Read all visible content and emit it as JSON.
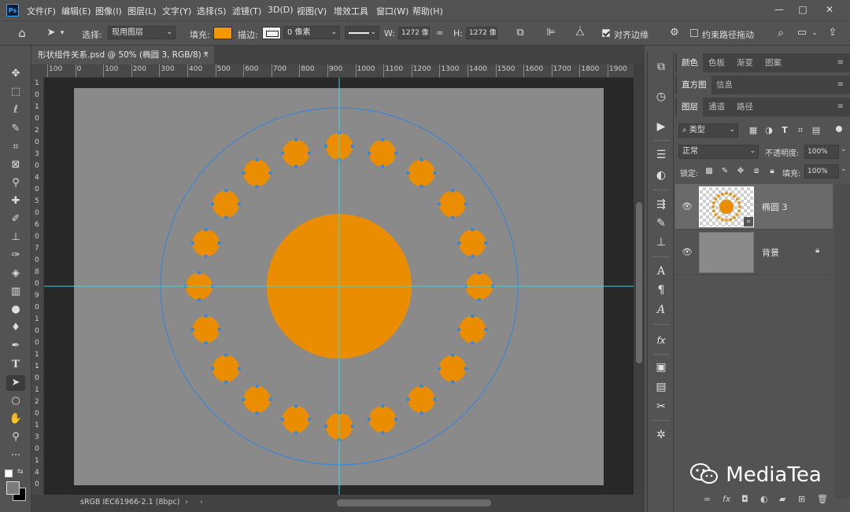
{
  "app": {
    "logo": "Ps",
    "menu": [
      "文件(F)",
      "编辑(E)",
      "图像(I)",
      "图层(L)",
      "文字(Y)",
      "选择(S)",
      "滤镜(T)",
      "3D(D)",
      "视图(V)",
      "增效工具",
      "窗口(W)",
      "帮助(H)"
    ],
    "window_controls": [
      "—",
      "□",
      "✕"
    ]
  },
  "options_bar": {
    "select_label": "选择:",
    "select_value": "现用图层",
    "fill_label": "填充:",
    "fill_color": "#F39800",
    "stroke_label": "描边:",
    "stroke_width": "0 像素",
    "w_label": "W:",
    "w_value": "1272 像",
    "h_label": "H:",
    "h_value": "1272 像",
    "align_edges_label": "对齐边缘",
    "align_edges_checked": true,
    "constrain_path_label": "约束路径拖动",
    "constrain_path_checked": false
  },
  "document": {
    "tab_title": "形状组件关系.psd @ 50% (椭圆 3, RGB/8) *",
    "close": "×",
    "status_text": "sRGB IEC61966-2.1 (8bpc)",
    "status_arrow": "›",
    "status_left_arrow": "‹",
    "ruler_h_ticks": [
      "100",
      "0",
      "100",
      "200",
      "300",
      "400",
      "500",
      "600",
      "700",
      "800",
      "900",
      "1000",
      "1100",
      "1200",
      "1300",
      "1400",
      "1500",
      "1600",
      "1700",
      "1800",
      "1900"
    ],
    "ruler_v_ticks": [
      "1",
      "0",
      "1",
      "0",
      "2",
      "0",
      "3",
      "0",
      "4",
      "0",
      "5",
      "0",
      "6",
      "0",
      "7",
      "0",
      "8",
      "0",
      "9",
      "0",
      "1",
      "0",
      "0",
      "1",
      "1",
      "0",
      "1",
      "2",
      "0",
      "1",
      "3",
      "0",
      "1",
      "4",
      "0"
    ],
    "canvas_color": "#8A8A8A",
    "shape_color": "#EB8D00",
    "path_color": "#3D86D3",
    "guide_color": "#36D5E3",
    "small_circle_count": 20
  },
  "panels": {
    "group1_tabs": [
      "颜色",
      "色板",
      "渐变",
      "图案"
    ],
    "group2_tabs": [
      "直方图",
      "信息"
    ],
    "group3_tabs": [
      "图层",
      "通道",
      "路径"
    ],
    "filter_label": "类型",
    "blend_mode": "正常",
    "opacity_label": "不透明度:",
    "opacity_value": "100%",
    "lock_label": "锁定:",
    "fill_label": "填充:",
    "fill_value": "100%",
    "layers": [
      {
        "name": "椭圆 3"
      },
      {
        "name": "背景"
      }
    ]
  },
  "watermark": {
    "text": "MediaTea"
  }
}
